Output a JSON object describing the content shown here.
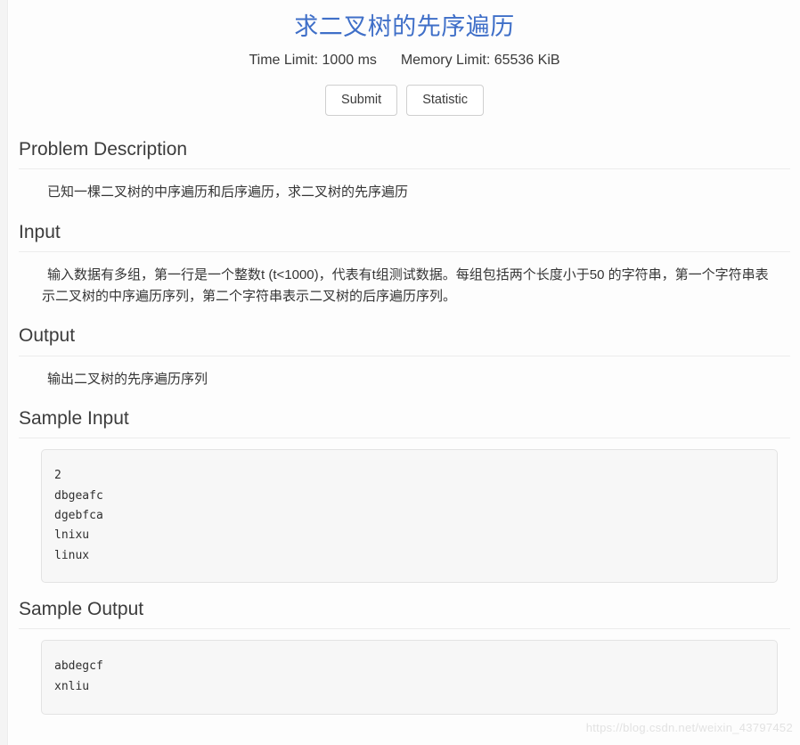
{
  "problem": {
    "title": "求二叉树的先序遍历",
    "title_color": "#3f6fc8",
    "time_limit_label": "Time Limit: 1000 ms",
    "memory_limit_label": "Memory Limit: 65536 KiB"
  },
  "actions": {
    "submit_label": "Submit",
    "statistic_label": "Statistic"
  },
  "sections": {
    "description": {
      "heading": "Problem Description",
      "body": "已知一棵二叉树的中序遍历和后序遍历，求二叉树的先序遍历"
    },
    "input": {
      "heading": "Input",
      "body": "输入数据有多组，第一行是一个整数t (t<1000)，代表有t组测试数据。每组包括两个长度小于50 的字符串，第一个字符串表示二叉树的中序遍历序列，第二个字符串表示二叉树的后序遍历序列。"
    },
    "output": {
      "heading": "Output",
      "body": "输出二叉树的先序遍历序列"
    },
    "sample_input": {
      "heading": "Sample Input",
      "content": "2\ndbgeafc\ndgebfca\nlnixu\nlinux"
    },
    "sample_output": {
      "heading": "Sample Output",
      "content": "abdegcf\nxnliu"
    }
  },
  "watermark": {
    "text": "https://blog.csdn.net/weixin_43797452"
  }
}
